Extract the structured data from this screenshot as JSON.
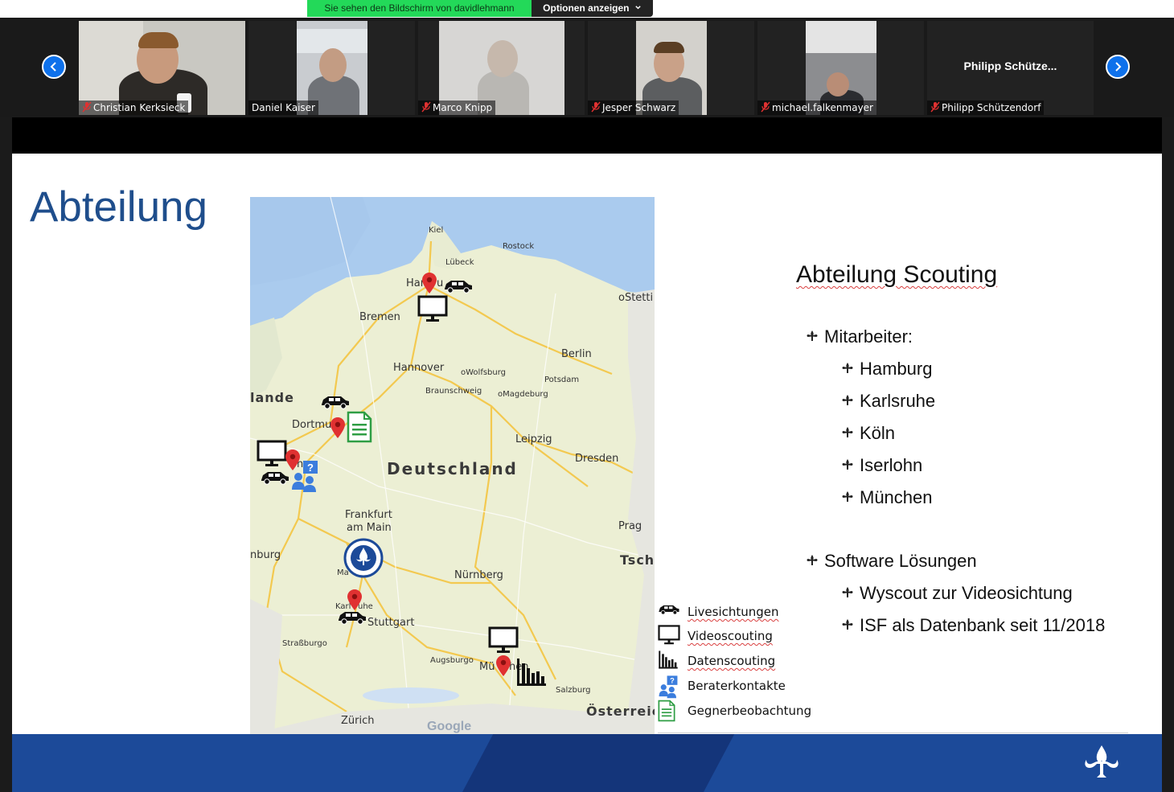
{
  "meeting": {
    "share_banner": "Sie sehen den Bildschirm von davidlehmann",
    "options_label": "Optionen anzeigen"
  },
  "participants": [
    {
      "name": "Christian Kerksieck",
      "muted": true
    },
    {
      "name": "Daniel Kaiser",
      "muted": false
    },
    {
      "name": "Marco Knipp",
      "muted": true
    },
    {
      "name": "Jesper Schwarz",
      "muted": true
    },
    {
      "name": "michael.falkenmayer",
      "muted": true
    },
    {
      "name": "Philipp Schützendorf",
      "muted": true,
      "center_label": "Philipp  Schütze..."
    }
  ],
  "slide": {
    "title": "Abteilung",
    "content_title": "Abteilung Scouting",
    "sections": [
      {
        "label": "Mitarbeiter:",
        "items": [
          "Hamburg",
          "Karlsruhe",
          "Köln",
          "Iserlohn",
          "München"
        ]
      },
      {
        "label": "Software Lösungen",
        "items": [
          "Wyscout zur Videosichtung",
          "ISF als Datenbank seit 11/2018"
        ]
      }
    ],
    "legend": [
      "Livesichtungen",
      "Videoscouting",
      "Datenscouting",
      "Beraterkontakte",
      "Gegnerbeobachtung"
    ],
    "map": {
      "labels": {
        "kiel": "Kiel",
        "rostock": "Rostock",
        "luebeck": "Lübeck",
        "hamburg": "Ham",
        "hamburg2": "u",
        "stettin": "oStetti",
        "bremen": "Bremen",
        "hannover": "Hannover",
        "wolfsburg": "oWolfsburg",
        "braunschweig": "Braunschweig",
        "magdeburg": "oMagdeburg",
        "berlin": "Berlin",
        "potsdam": "Potsdam",
        "holland": "lande",
        "dortmund": "Dortmu",
        "leipzig": "Leipzig",
        "dresden": "Dresden",
        "deutschland": "Deutschland",
        "koeln": "n",
        "frankfurt": "Frankfurt",
        "amMain": "am Main",
        "prag": "Prag",
        "tsch": "Tsch",
        "nburg": "nburg",
        "mannheim": "Ma",
        "nuernberg": "Nürnberg",
        "karlsruhe": "Karl",
        "karlsruhe2": "uhe",
        "stuttgart": "Stuttgart",
        "strassburg": "Straßburgo",
        "augsburg": "Augsburgo",
        "muenchen": "Mü",
        "muenchen2": "hen",
        "salzburg": "Salzburg",
        "oesterreich": "Österreic",
        "zuerich": "Zürich",
        "google": "Google"
      }
    }
  },
  "colors": {
    "zoom_green": "#23d959",
    "zoom_blue": "#0e71eb",
    "title_blue": "#1f4e8c",
    "footer_blue": "#1c4a99",
    "pin_red": "#e03131"
  }
}
